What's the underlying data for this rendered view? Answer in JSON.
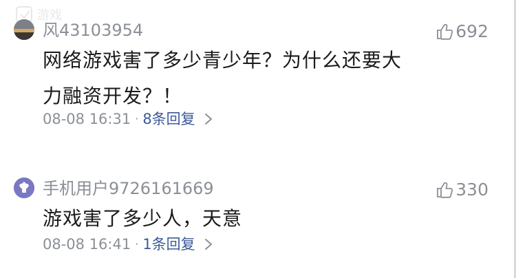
{
  "watermark": {
    "text": "游戏"
  },
  "comments": [
    {
      "username": "风43103954",
      "likes": "692",
      "text_lines": [
        "网络游戏害了多少青少年？为什么还要大",
        "力融资开发？！"
      ],
      "time": "08-08 16:31",
      "replies": "8条回复"
    },
    {
      "username": "手机用户9726161669",
      "likes": "330",
      "text_lines": [
        "游戏害了多少人，天意"
      ],
      "time": "08-08 16:41",
      "replies": "1条回复"
    }
  ],
  "icons": {
    "like": "thumbs-up-icon",
    "chevron": "chevron-right-icon"
  },
  "colors": {
    "meta_gray": "#8b8f96",
    "reply_blue": "#3b5a99",
    "text": "#1a1a1a"
  }
}
